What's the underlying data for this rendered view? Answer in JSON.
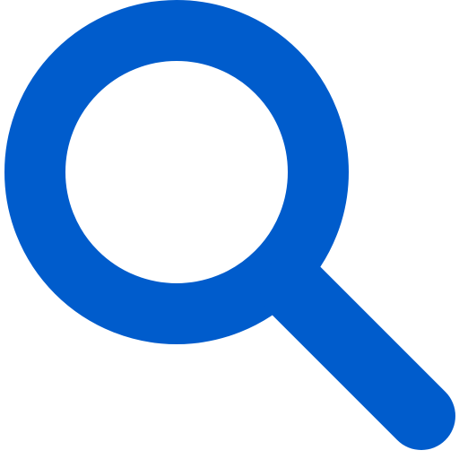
{
  "icon": {
    "name": "search-icon",
    "color": "#005ccc",
    "background": "#ffffff"
  }
}
